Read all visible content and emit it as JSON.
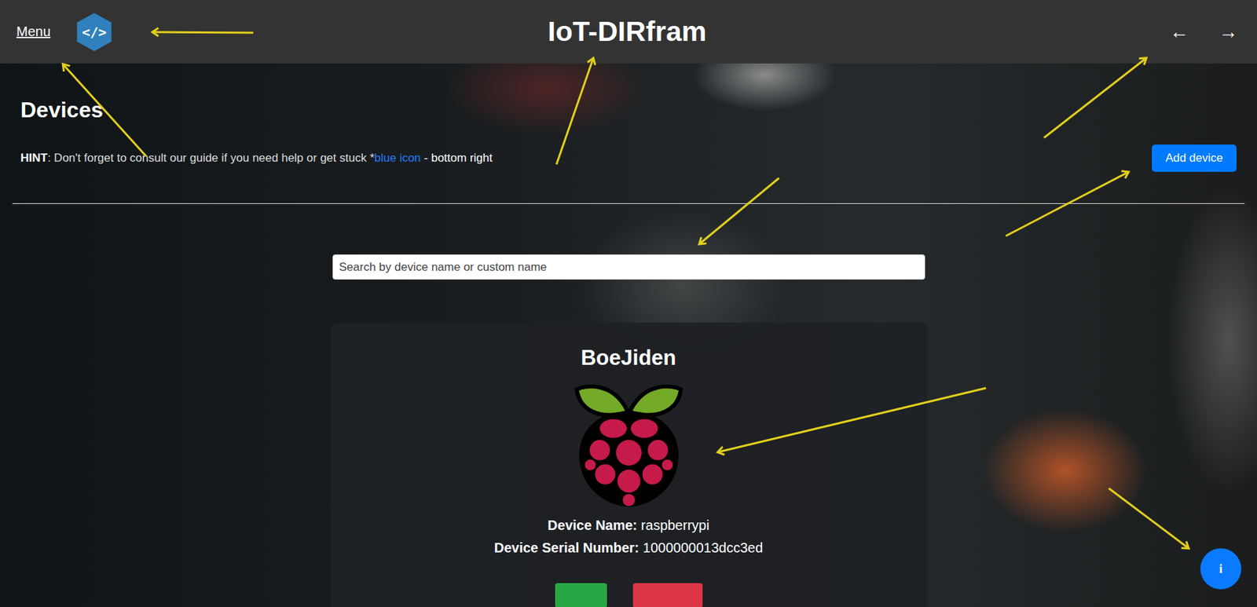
{
  "nav": {
    "menu": "Menu",
    "logo": "</>",
    "title": "IoT-DIRfram",
    "back": "←",
    "forward": "→"
  },
  "page": {
    "title": "Devices",
    "hint": {
      "label": "HINT",
      "text": ": Don't forget to consult our guide if you need help or get stuck *",
      "link": "blue icon",
      "tail": " - bottom right"
    },
    "add_button": "Add device"
  },
  "search": {
    "placeholder": "Search by device name or custom name"
  },
  "devices": [
    {
      "custom_name": "BoeJiden",
      "fields": [
        {
          "label": "Device Name:",
          "value": "raspberrypi"
        },
        {
          "label": "Device Serial Number:",
          "value": "1000000013dcc3ed"
        }
      ]
    }
  ],
  "info_button": "i"
}
